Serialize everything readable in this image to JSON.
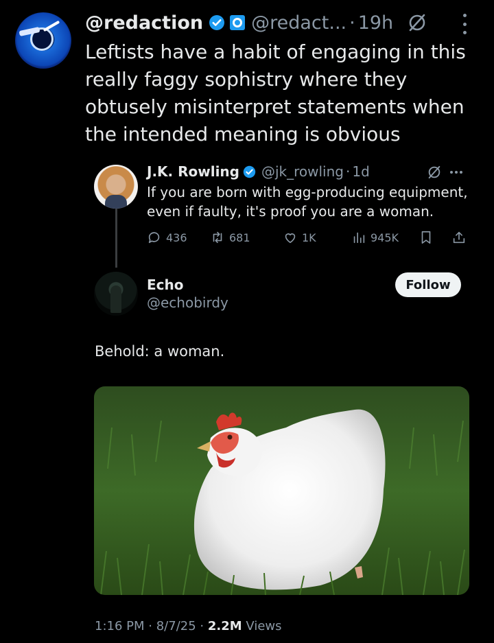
{
  "tweet": {
    "display_name": "@redaction",
    "handle": "@redact...",
    "separator": "·",
    "time": "19h",
    "text": "Leftists have a habit of engaging in this really faggy sophistry where they obtusely misinterpret statements when the intended meaning is obvious"
  },
  "quoted": {
    "name": "J.K. Rowling",
    "handle": "@jk_rowling",
    "separator": "·",
    "time": "1d",
    "text": "If you are born with egg-producing equipment, even if faulty, it's proof you are a woman.",
    "actions": {
      "replies": "436",
      "reposts": "681",
      "likes": "1K",
      "views": "945K"
    }
  },
  "reply": {
    "name": "Echo",
    "handle": "@echobirdy",
    "follow_label": "Follow",
    "text": "Behold: a woman."
  },
  "footer": {
    "time": "1:16 PM",
    "sep1": "·",
    "date": "8/7/25",
    "sep2": "·",
    "views_count": "2.2M",
    "views_label": "Views"
  },
  "colors": {
    "background": "#000000",
    "text": "#e7e9ea",
    "muted": "#8b98a5",
    "verified": "#1d9bf0"
  },
  "icons": [
    "grok-icon",
    "more-icon",
    "verified-badge-icon",
    "reply-icon",
    "repost-icon",
    "like-icon",
    "views-icon",
    "bookmark-icon",
    "share-icon"
  ]
}
